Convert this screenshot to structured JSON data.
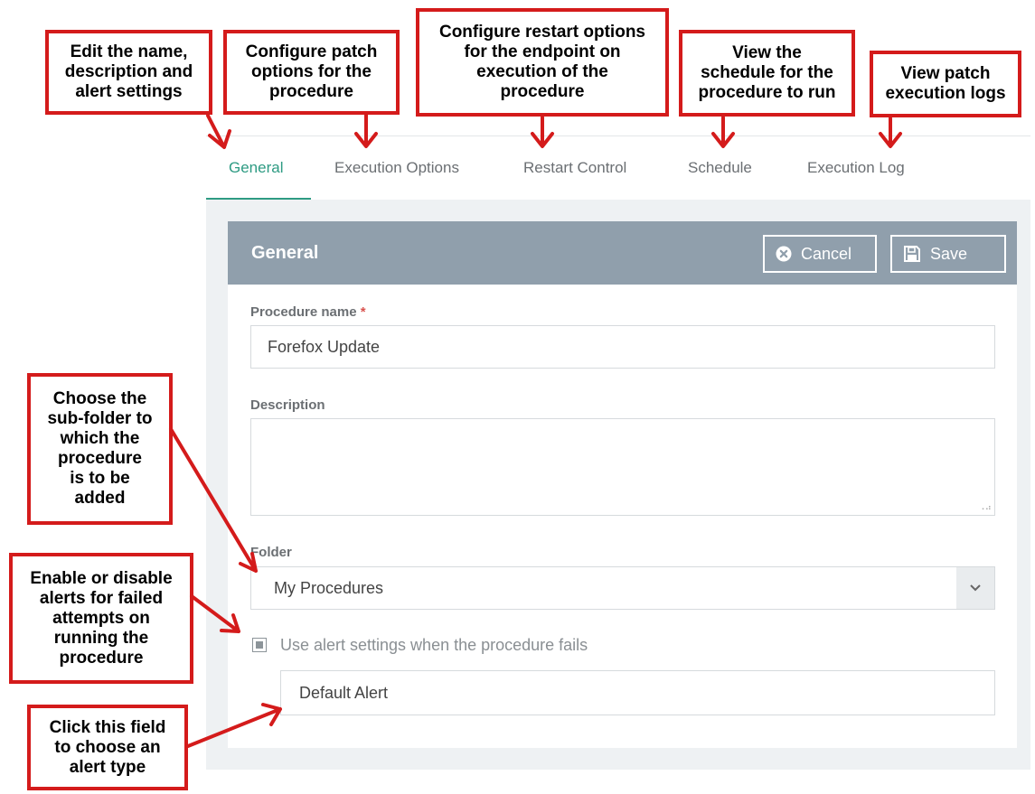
{
  "tabs": [
    {
      "label": "General",
      "active": true
    },
    {
      "label": "Execution Options",
      "active": false
    },
    {
      "label": "Restart Control",
      "active": false
    },
    {
      "label": "Schedule",
      "active": false
    },
    {
      "label": "Execution Log",
      "active": false
    }
  ],
  "card": {
    "title": "General",
    "cancel_label": "Cancel",
    "save_label": "Save"
  },
  "form": {
    "procedure_name_label": "Procedure name",
    "required_mark": "*",
    "procedure_name_value": "Forefox Update",
    "description_label": "Description",
    "description_value": "",
    "folder_label": "Folder",
    "folder_value": "My Procedures",
    "alert_checkbox_label": "Use alert settings when the procedure fails",
    "alert_checkbox_checked": true,
    "alert_value": "Default Alert"
  },
  "callouts": {
    "general": "Edit the name,\ndescription and\nalert settings",
    "execution_options": "Configure patch\noptions for the\nprocedure",
    "restart_control": "Configure restart options\nfor the endpoint on\nexecution of the\nprocedure",
    "schedule": "View the\nschedule for the\nprocedure to run",
    "execution_log": "View patch\nexecution logs",
    "folder": "Choose the\nsub-folder to\nwhich the\nprocedure\nis to be\nadded",
    "alerts": "Enable or disable\nalerts for failed\nattempts on\nrunning the\nprocedure",
    "alert_field": "Click this field\nto choose an\nalert type"
  },
  "colors": {
    "accent": "#2e9b83",
    "header": "#909fac",
    "annotation": "#d41b1b"
  },
  "icons": {
    "cancel": "close-circle-icon",
    "save": "floppy-disk-icon",
    "dropdown": "chevron-down-icon",
    "checkbox": "checkbox-icon"
  }
}
